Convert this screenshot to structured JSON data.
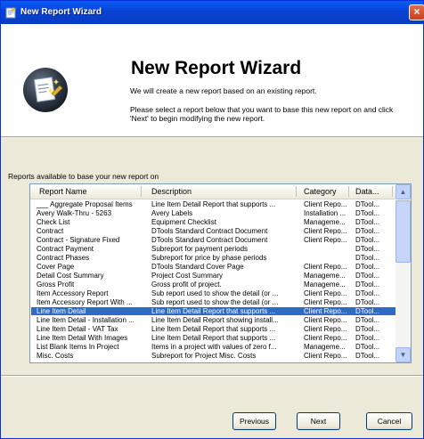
{
  "window": {
    "title": "New Report Wizard",
    "close_symbol": "×"
  },
  "header": {
    "title": "New Report Wizard",
    "line1": "We will create a new report based on an existing report.",
    "line2": "Please select a report below that you want to base this new report on and click 'Next' to begin modifying the new report."
  },
  "list": {
    "label": "Reports available to base your new report on",
    "columns": [
      "Report Name",
      "Description",
      "Category",
      "Data..."
    ],
    "rows": [
      [
        "___ Aggregate Proposal Items",
        "Line Item Detail Report that supports ...",
        "Client Repo...",
        "DTool..."
      ],
      [
        "Avery Walk-Thru - 5263",
        "Avery Labels",
        "Installation ...",
        "DTool..."
      ],
      [
        "Check List",
        "Equipment Checklist",
        "Manageme...",
        "DTool..."
      ],
      [
        "Contract",
        "DTools Standard Contract Document",
        "Client Repo...",
        "DTool..."
      ],
      [
        "Contract - Signature Fixed",
        "DTools Standard Contract Document",
        "Client Repo...",
        "DTool..."
      ],
      [
        "Contract Payment",
        "Subreport for payment periods",
        "",
        "DTool..."
      ],
      [
        "Contract Phases",
        "Subreport for price by phase periods",
        "",
        "DTool..."
      ],
      [
        "Cover Page",
        "DTools Standard Cover Page",
        "Client Repo...",
        "DTool..."
      ],
      [
        "Detail Cost Summary",
        "Project Cost Summary",
        "Manageme...",
        "DTool..."
      ],
      [
        "Gross Profit",
        "Gross profit of project.",
        "Manageme...",
        "DTool..."
      ],
      [
        "Item Accessory Report",
        "Sub report used to show the detail (or ...",
        "Client Repo...",
        "DTool..."
      ],
      [
        "Item Accessory Report With ...",
        "Sub report used to show the detail (or ...",
        "Client Repo...",
        "DTool..."
      ],
      [
        "Line Item Detail",
        "Line Item Detail Report that supports ...",
        "Client Repo...",
        "DTool..."
      ],
      [
        "Line Item Detail - Installation ...",
        "Line Item Detail Report showing install...",
        "Client Repo...",
        "DTool..."
      ],
      [
        "Line Item Detail - VAT Tax",
        "Line Item Detail Report that supports ...",
        "Client Repo...",
        "DTool..."
      ],
      [
        "Line Item Detail With Images",
        "Line Item Detail Report that supports ...",
        "Client Repo...",
        "DTool..."
      ],
      [
        "List Blank Items In Project",
        "Items in a project with values of zero f...",
        "Manageme...",
        "DTool..."
      ],
      [
        "Misc. Costs",
        "Subreport for Project Misc. Costs",
        "Client Repo...",
        "DTool..."
      ]
    ],
    "selected_index": 12
  },
  "buttons": {
    "previous": "Previous",
    "next": "Next",
    "cancel": "Cancel"
  },
  "scrollbar": {
    "up": "▲",
    "down": "▼"
  },
  "colors": {
    "titlebar": "#0a5cf5",
    "selection": "#316ac5"
  }
}
